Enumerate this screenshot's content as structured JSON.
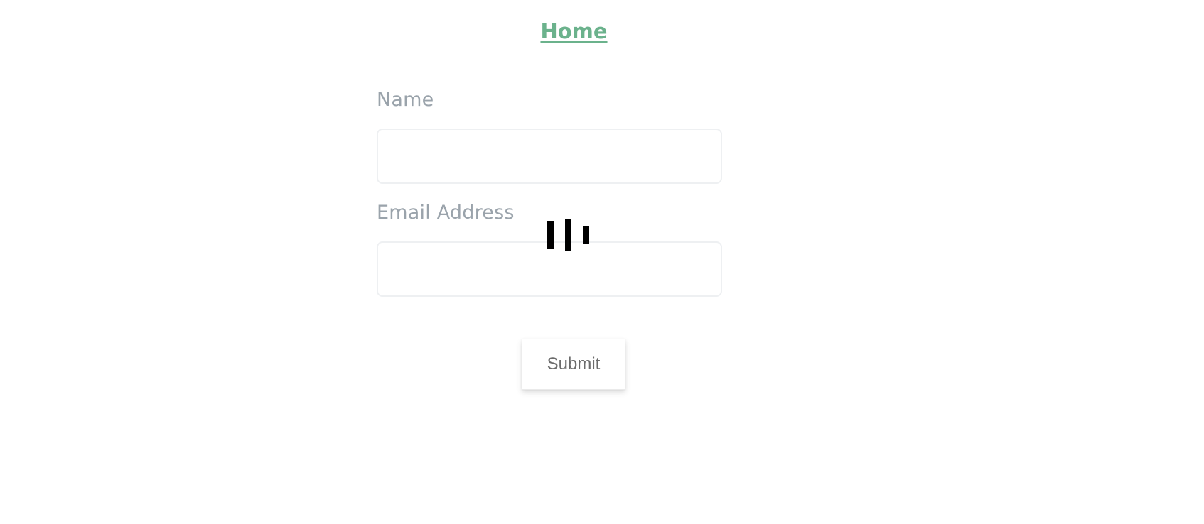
{
  "nav": {
    "home_label": "Home",
    "home_color": "#6bb28c"
  },
  "form": {
    "name_label": "Name",
    "name_value": "",
    "email_label": "Email Address",
    "email_value": "",
    "submit_label": "Submit"
  },
  "loading": {
    "icon": "loading-bars-icon"
  },
  "colors": {
    "label": "#9aa3ab",
    "field_border": "#eef0f2",
    "button_text": "#6b6b6b"
  }
}
